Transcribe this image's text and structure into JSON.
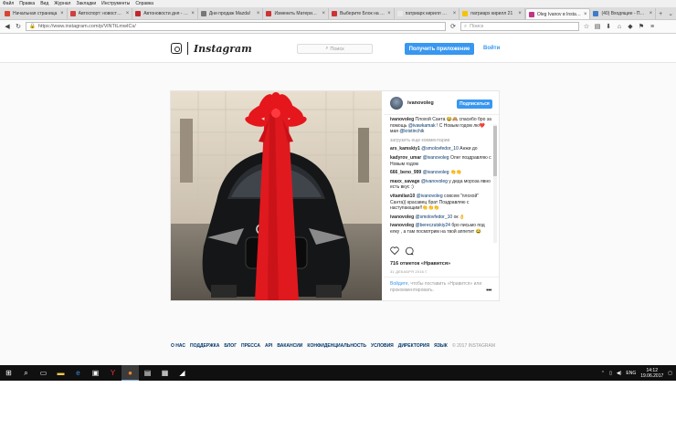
{
  "menu": [
    "Файл",
    "Правка",
    "Вид",
    "Журнал",
    "Закладки",
    "Инструменты",
    "Справка"
  ],
  "tabs": [
    {
      "title": "Начальная страница",
      "color": "#d8442f"
    },
    {
      "title": "Автоспорт: новости Ф",
      "color": "#d23d3d"
    },
    {
      "title": "Автоновости дня - авт",
      "color": "#c0272d"
    },
    {
      "title": "Дни продаж Mazda!",
      "color": "#777777"
    },
    {
      "title": "Изменить Материал |",
      "color": "#cc3333"
    },
    {
      "title": "Выберите Блок на гла",
      "color": "#cc3333"
    },
    {
      "title": "патриарх кирилл — Я",
      "color": "#e8e8e8"
    },
    {
      "title": "патриарх кирилл 21",
      "color": "#f5c400"
    },
    {
      "title": "Oleg Ivanov в Instagran",
      "color": "#c13584",
      "active": true
    },
    {
      "title": "(40) Входящие - Почта",
      "color": "#3d7cc9"
    }
  ],
  "nav": {
    "url": "https://www.instagram.com/p/ViNTtLmwICs/",
    "search_placeholder": "Поиск"
  },
  "ig": {
    "wordmark": "Instagram",
    "search_placeholder": "Поиск",
    "get_app": "Получить приложение",
    "login": "Войти"
  },
  "post": {
    "username": "ivanovoleg",
    "follow": "Подписаться",
    "caption_user": "ivanovoleg",
    "caption_text": "Плохой Санта 😂🙈 спасибо бро за помощь",
    "caption_m1": "@ivawkamak",
    "caption_rest": "! С Новым годом лю❤️мая",
    "caption_m2": "@kristinchik",
    "load_more": "загрузить еще комментарии",
    "comments": [
      {
        "user": "ars_kamskiy1",
        "mention": "@smolovfedor_10",
        "text": "Анжи до"
      },
      {
        "user": "kadyrov_umar",
        "mention": "@ivanovoleg",
        "text": "Олег поздравляю с Новым годом"
      },
      {
        "user": "666_beno_999",
        "mention": "@ivanovoleg",
        "text": "👏👏"
      },
      {
        "user": "maxx_savage",
        "mention": "@ivanovoleg",
        "text": "у деда мороза явно есть вкус :)"
      },
      {
        "user": "vitamilan10",
        "mention": "@ivanovoleg",
        "text": "совсем \"плохой\" Санта)) красавец брат Поздравляю с наступающим!!👏👏👏"
      },
      {
        "user": "ivanovoleg",
        "mention": "@smolovfedor_10",
        "text": "ок 👌"
      },
      {
        "user": "ivanovoleg",
        "mention": "@bereczutskiy24",
        "text": "бро письмо под елку , а там посмотрим на твой аппетит 😂"
      }
    ],
    "likes": "716 отметок «Нравится»",
    "date": "31 ДЕКАБРЯ 2016 Г.",
    "add_login": "Войдите",
    "add_rest": ", чтобы поставить «Нравится» или прокомментировать.",
    "more": "•••"
  },
  "footer": {
    "links": [
      "О НАС",
      "ПОДДЕРЖКА",
      "БЛОГ",
      "ПРЕССА",
      "API",
      "ВАКАНСИИ",
      "КОНФИДЕНЦИАЛЬНОСТЬ",
      "УСЛОВИЯ",
      "ДИРЕКТОРИЯ",
      "ЯЗЫК"
    ],
    "copyright": "© 2017 INSTAGRAM"
  },
  "taskbar": {
    "lang": "ENG",
    "time": "14:12",
    "date": "19.06.2017"
  }
}
